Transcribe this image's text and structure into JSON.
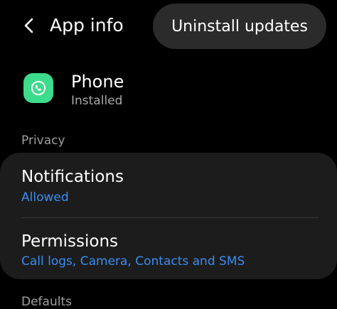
{
  "header": {
    "title": "App info",
    "uninstall_label": "Uninstall updates"
  },
  "app": {
    "name": "Phone",
    "status": "Installed",
    "icon": "phone-icon"
  },
  "sections": {
    "privacy": "Privacy",
    "defaults": "Defaults"
  },
  "privacy_items": [
    {
      "title": "Notifications",
      "subtitle": "Allowed"
    },
    {
      "title": "Permissions",
      "subtitle": "Call logs, Camera, Contacts and SMS"
    }
  ],
  "colors": {
    "background": "#000000",
    "card": "#1c1c1c",
    "accent": "#3a8df2",
    "app_icon": "#3ddc8c"
  }
}
